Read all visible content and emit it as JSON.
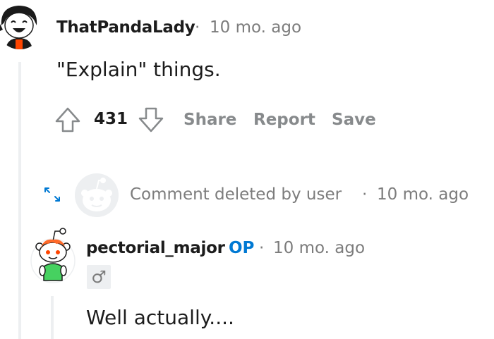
{
  "comment1": {
    "username": "ThatPandaLady",
    "separator": "·",
    "time": "10 mo. ago",
    "body": "\"Explain\" things.",
    "votes": "431",
    "actions": {
      "share": "Share",
      "report": "Report",
      "save": "Save"
    }
  },
  "comment2": {
    "deleted_text": "Comment deleted by user",
    "separator": "·",
    "time": "10 mo. ago"
  },
  "comment3": {
    "username": "pectorial_major",
    "op_badge": "OP",
    "separator": "·",
    "time": "10 mo. ago",
    "flair": "♂",
    "body": "Well actually...."
  },
  "colors": {
    "thread_line": "#edeff1",
    "meta_text": "#7c7c7c",
    "action_text": "#878a8c",
    "op_blue": "#0079d3",
    "expand_icon": "#0079d3"
  }
}
